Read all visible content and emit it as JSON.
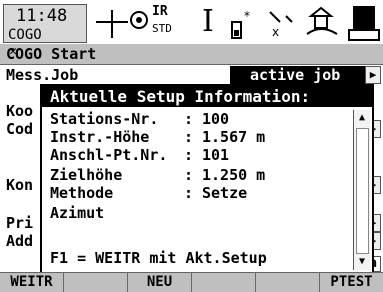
{
  "status": {
    "time": "11:48",
    "app": "COGO",
    "ir": "IR",
    "std": "STD",
    "cursor": "I"
  },
  "title": "COGO Start",
  "background": {
    "line1_label": "Mess.Job",
    "line1_value": "active job",
    "line2": "Koo",
    "line3": "Cod",
    "line4": "Kon",
    "line5": "Pri",
    "line6": "Add"
  },
  "dialog": {
    "header": "Aktuelle Setup Information:",
    "rows": [
      {
        "label": "Stations-Nr.",
        "colon": ":",
        "value": "100"
      },
      {
        "label": "Instr.-Höhe",
        "colon": ":",
        "value": "1.567 m"
      },
      {
        "label": "Anschl-Pt.Nr.",
        "colon": ":",
        "value": "101"
      },
      {
        "label": "Zielhöhe",
        "colon": ":",
        "value": "1.250 m"
      },
      {
        "label": "Methode",
        "colon": ":",
        "value": "Setze"
      },
      {
        "label": "Azimut",
        "colon": "",
        "value": ""
      }
    ],
    "footer": "F1 = WEITR mit Akt.Setup"
  },
  "fkeys": [
    "WEITR",
    "",
    "NEU",
    "",
    "",
    "PTEST"
  ],
  "side_a": "a"
}
